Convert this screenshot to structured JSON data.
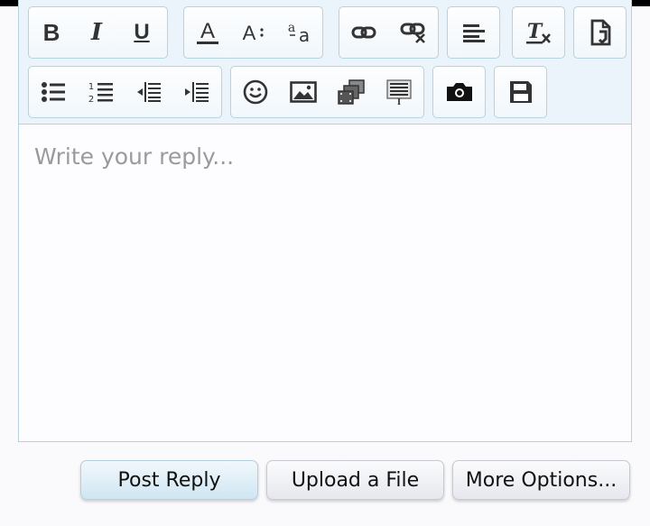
{
  "editor": {
    "placeholder": "Write your reply...",
    "toolbar_row1": [
      {
        "name": "bold-button",
        "icon": "bold-icon",
        "glyph": "B"
      },
      {
        "name": "italic-button",
        "icon": "italic-icon",
        "glyph": "I"
      },
      {
        "name": "underline-button",
        "icon": "underline-icon",
        "glyph": "U"
      },
      {
        "name": "text-color-button",
        "icon": "text-color-icon"
      },
      {
        "name": "font-size-button",
        "icon": "font-size-icon"
      },
      {
        "name": "font-family-button",
        "icon": "font-family-icon"
      },
      {
        "name": "insert-link-button",
        "icon": "link-icon"
      },
      {
        "name": "remove-link-button",
        "icon": "unlink-icon"
      },
      {
        "name": "align-button",
        "icon": "align-left-icon"
      },
      {
        "name": "remove-format-button",
        "icon": "clear-format-icon"
      },
      {
        "name": "switch-editor-button",
        "icon": "file-toggle-icon"
      }
    ],
    "toolbar_row2": [
      {
        "name": "bulleted-list-button",
        "icon": "bulleted-list-icon"
      },
      {
        "name": "numbered-list-button",
        "icon": "numbered-list-icon"
      },
      {
        "name": "outdent-button",
        "icon": "outdent-icon"
      },
      {
        "name": "indent-button",
        "icon": "indent-icon"
      },
      {
        "name": "smilies-button",
        "icon": "smiley-icon"
      },
      {
        "name": "insert-image-button",
        "icon": "image-icon"
      },
      {
        "name": "insert-media-button",
        "icon": "media-icon"
      },
      {
        "name": "insert-quote-button",
        "icon": "quote-block-icon"
      },
      {
        "name": "camera-button",
        "icon": "camera-icon"
      },
      {
        "name": "save-draft-button",
        "icon": "save-icon"
      }
    ]
  },
  "actions": {
    "post_reply": "Post Reply",
    "upload_file": "Upload a File",
    "more_options": "More Options..."
  },
  "colors": {
    "toolbar_bg": "#eaf4fa",
    "border": "#b8d2dc",
    "primary_button": "#cfe6f3",
    "icon": "#333333"
  }
}
